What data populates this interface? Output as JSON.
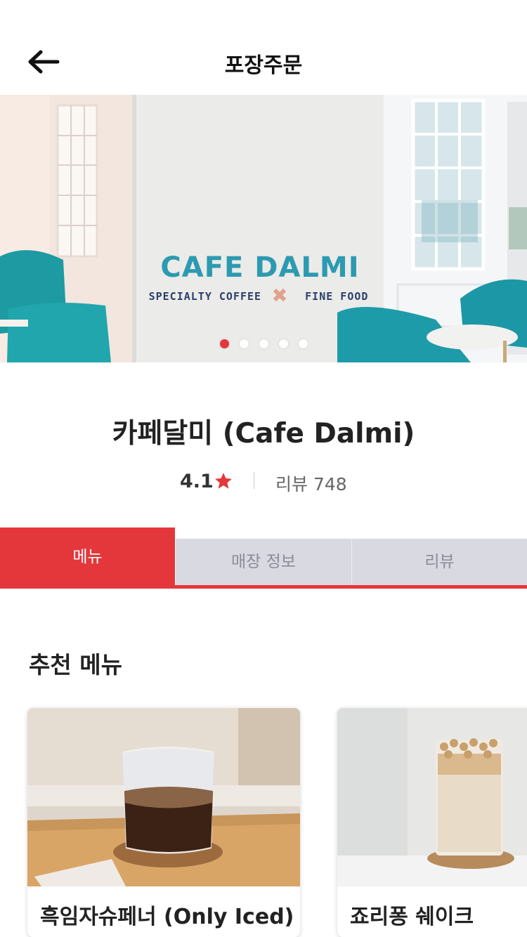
{
  "header": {
    "title": "포장주문",
    "back_icon": "arrow-left-icon"
  },
  "banner": {
    "sign_title": "CAFE DALMI",
    "sign_sub_left": "SPECIALTY COFFEE",
    "sign_sub_right": "FINE FOOD",
    "slide_count": 5,
    "active_slide": 1
  },
  "store": {
    "name": "카페달미 (Cafe Dalmi)",
    "rating": "4.1",
    "review_label": "리뷰 748"
  },
  "tabs": [
    {
      "label": "메뉴",
      "active": true
    },
    {
      "label": "매장 정보",
      "active": false
    },
    {
      "label": "리뷰",
      "active": false
    }
  ],
  "recommended": {
    "title": "추천 메뉴",
    "items": [
      {
        "name": "흑임자슈페너 (Only Iced)"
      },
      {
        "name": "죠리퐁 쉐이크"
      }
    ]
  },
  "colors": {
    "accent": "#e4373c",
    "tab_inactive": "#d9d9e2",
    "sign_teal": "#2c9ab0"
  }
}
